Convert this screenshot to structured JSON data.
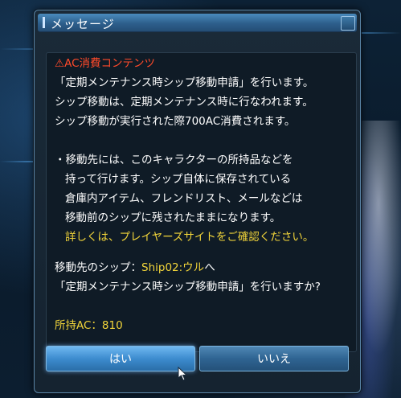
{
  "dialog": {
    "title": "メッセージ",
    "heading": "⚠AC消費コンテンツ",
    "lines": [
      "「定期メンテナンス時シップ移動申請」を行います。",
      "シップ移動は、定期メンテナンス時に行なわれます。",
      "シップ移動が実行された際700AC消費されます。"
    ],
    "bullet_lines": [
      "・移動先には、このキャラクターの所持品などを",
      "持って行けます。シップ自体に保存されている",
      "倉庫内アイテム、フレンドリスト、メールなどは",
      "移動前のシップに残されたままになります。"
    ],
    "notice": "詳しくは、プレイヤーズサイトをご確認ください。",
    "destination_label": "移動先のシップ：",
    "destination_value": "Ship02:ウル",
    "destination_suffix": "へ",
    "confirm_line": "「定期メンテナンス時シップ移動申請」を行いますか?",
    "ac_label": "所持AC：810"
  },
  "buttons": {
    "yes": "はい",
    "no": "いいえ"
  },
  "colors": {
    "warning": "#ff4a2a",
    "highlight": "#f2d53a",
    "accent": "#3d8ccf"
  },
  "icons": {
    "warning": "warning-icon",
    "close": "close-icon",
    "cursor": "mouse-cursor-icon"
  }
}
